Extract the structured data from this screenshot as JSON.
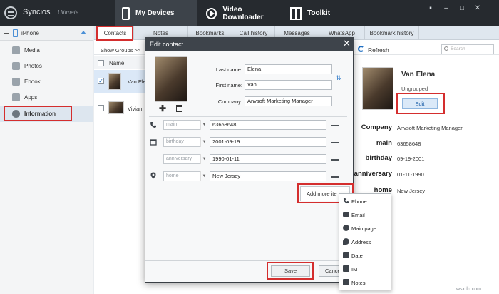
{
  "app": {
    "name": "Syncios",
    "edition": "Ultimate"
  },
  "topnav": {
    "devices": "My Devices",
    "video": "Video Downloader",
    "toolkit": "Toolkit"
  },
  "window_controls": {
    "menu": "▪",
    "minimize": "–",
    "maximize": "□",
    "close": "✕"
  },
  "device": {
    "name": "iPhone"
  },
  "sidebar": {
    "items": [
      {
        "label": "Media",
        "icon": "music-icon"
      },
      {
        "label": "Photos",
        "icon": "photo-icon"
      },
      {
        "label": "Ebook",
        "icon": "book-icon"
      },
      {
        "label": "Apps",
        "icon": "apps-icon"
      },
      {
        "label": "Information",
        "icon": "info-icon"
      }
    ]
  },
  "tabs": [
    "Contacts",
    "Notes",
    "Bookmarks",
    "Call history",
    "Messages",
    "WhatsApp",
    "Bookmark history"
  ],
  "toolbar": {
    "show_groups": "Show Groups >>",
    "refresh": "Refresh",
    "search_placeholder": "Search"
  },
  "list": {
    "header": "Name",
    "rows": [
      {
        "name": "Van Ele",
        "checked": true
      },
      {
        "name": "Vivian",
        "checked": false
      }
    ]
  },
  "detail": {
    "name": "Van Elena",
    "group": "Ungrouped",
    "edit": "Edit",
    "fields": [
      {
        "label": "Company",
        "value": "Anvsoft Marketing Manager"
      },
      {
        "label": "main",
        "value": "63658648"
      },
      {
        "label": "birthday",
        "value": "09-19-2001"
      },
      {
        "label": "anniversary",
        "value": "01-11-1990"
      },
      {
        "label": "home",
        "value": "New Jersey"
      }
    ]
  },
  "dialog": {
    "title": "Edit contact",
    "close": "✕",
    "last_name_label": "Last name:",
    "last_name": "Elena",
    "first_name_label": "First name:",
    "first_name": "Van",
    "company_label": "Company:",
    "company": "Anvsoft Marketing Manager",
    "add_photo": "✚",
    "rows": [
      {
        "icon": "phone-icon",
        "type": "main",
        "value": "63658648"
      },
      {
        "icon": "calendar-icon",
        "type": "birthday",
        "value": "2001-09-19"
      },
      {
        "icon": "",
        "type": "anniversary",
        "value": "1990-01-11"
      },
      {
        "icon": "location-icon",
        "type": "home",
        "value": "New Jersey"
      }
    ],
    "add_more": "Add more ite",
    "save": "Save",
    "cancel": "Cance"
  },
  "add_menu": [
    "Phone",
    "Email",
    "Main page",
    "Address",
    "Date",
    "IM",
    "Notes"
  ],
  "watermark": "wsxdn.com"
}
